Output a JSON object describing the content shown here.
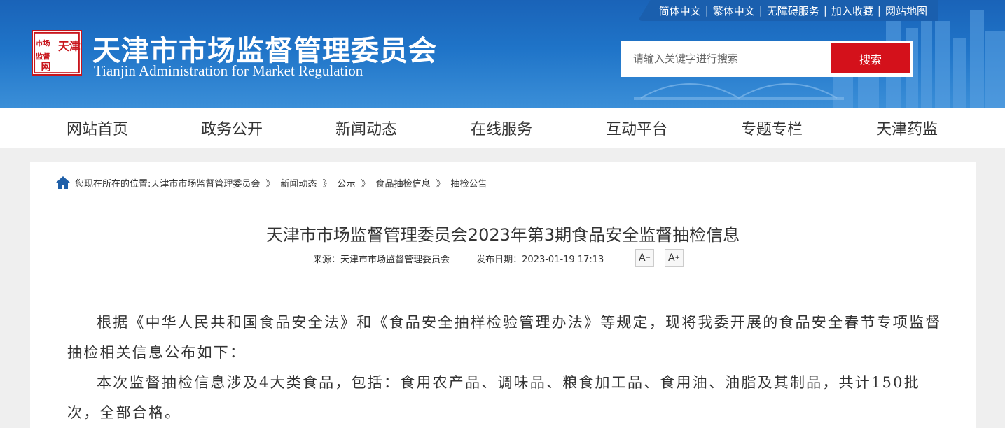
{
  "header": {
    "top_links": [
      "简体中文",
      "繁体中文",
      "无障碍服务",
      "加入收藏",
      "网站地图"
    ],
    "logo_seal_chars": [
      "天津",
      "市场",
      "监督",
      "网"
    ],
    "site_name_cn": "天津市市场监督管理委员会",
    "site_name_en": "Tianjin Administration for Market Regulation",
    "search": {
      "placeholder": "请输入关键字进行搜索",
      "button_label": "搜索"
    }
  },
  "nav": [
    "网站首页",
    "政务公开",
    "新闻动态",
    "在线服务",
    "互动平台",
    "专题专栏",
    "天津药监"
  ],
  "breadcrumb": {
    "prefix": "您现在所在的位置:",
    "items": [
      "天津市市场监督管理委员会",
      "新闻动态",
      "公示",
      "食品抽检信息",
      "抽检公告"
    ],
    "separator": "》"
  },
  "article": {
    "title": "天津市市场监督管理委员会2023年第3期食品安全监督抽检信息",
    "source": "来源：天津市市场监督管理委员会",
    "date": "发布日期：2023-01-19 17:13",
    "font_smaller": "A",
    "font_larger": "A",
    "paragraphs": [
      "根据《中华人民共和国食品安全法》和《食品安全抽样检验管理办法》等规定，现将我委开展的食品安全春节专项监督抽检相关信息公布如下：",
      "本次监督抽检信息涉及4大类食品，包括：食用农产品、调味品、粮食加工品、食用油、油脂及其制品，共计150批次，全部合格。"
    ]
  },
  "colors": {
    "header_blue": "#1f74c8",
    "search_red": "#d4111b",
    "seal_red": "#c8161d"
  }
}
